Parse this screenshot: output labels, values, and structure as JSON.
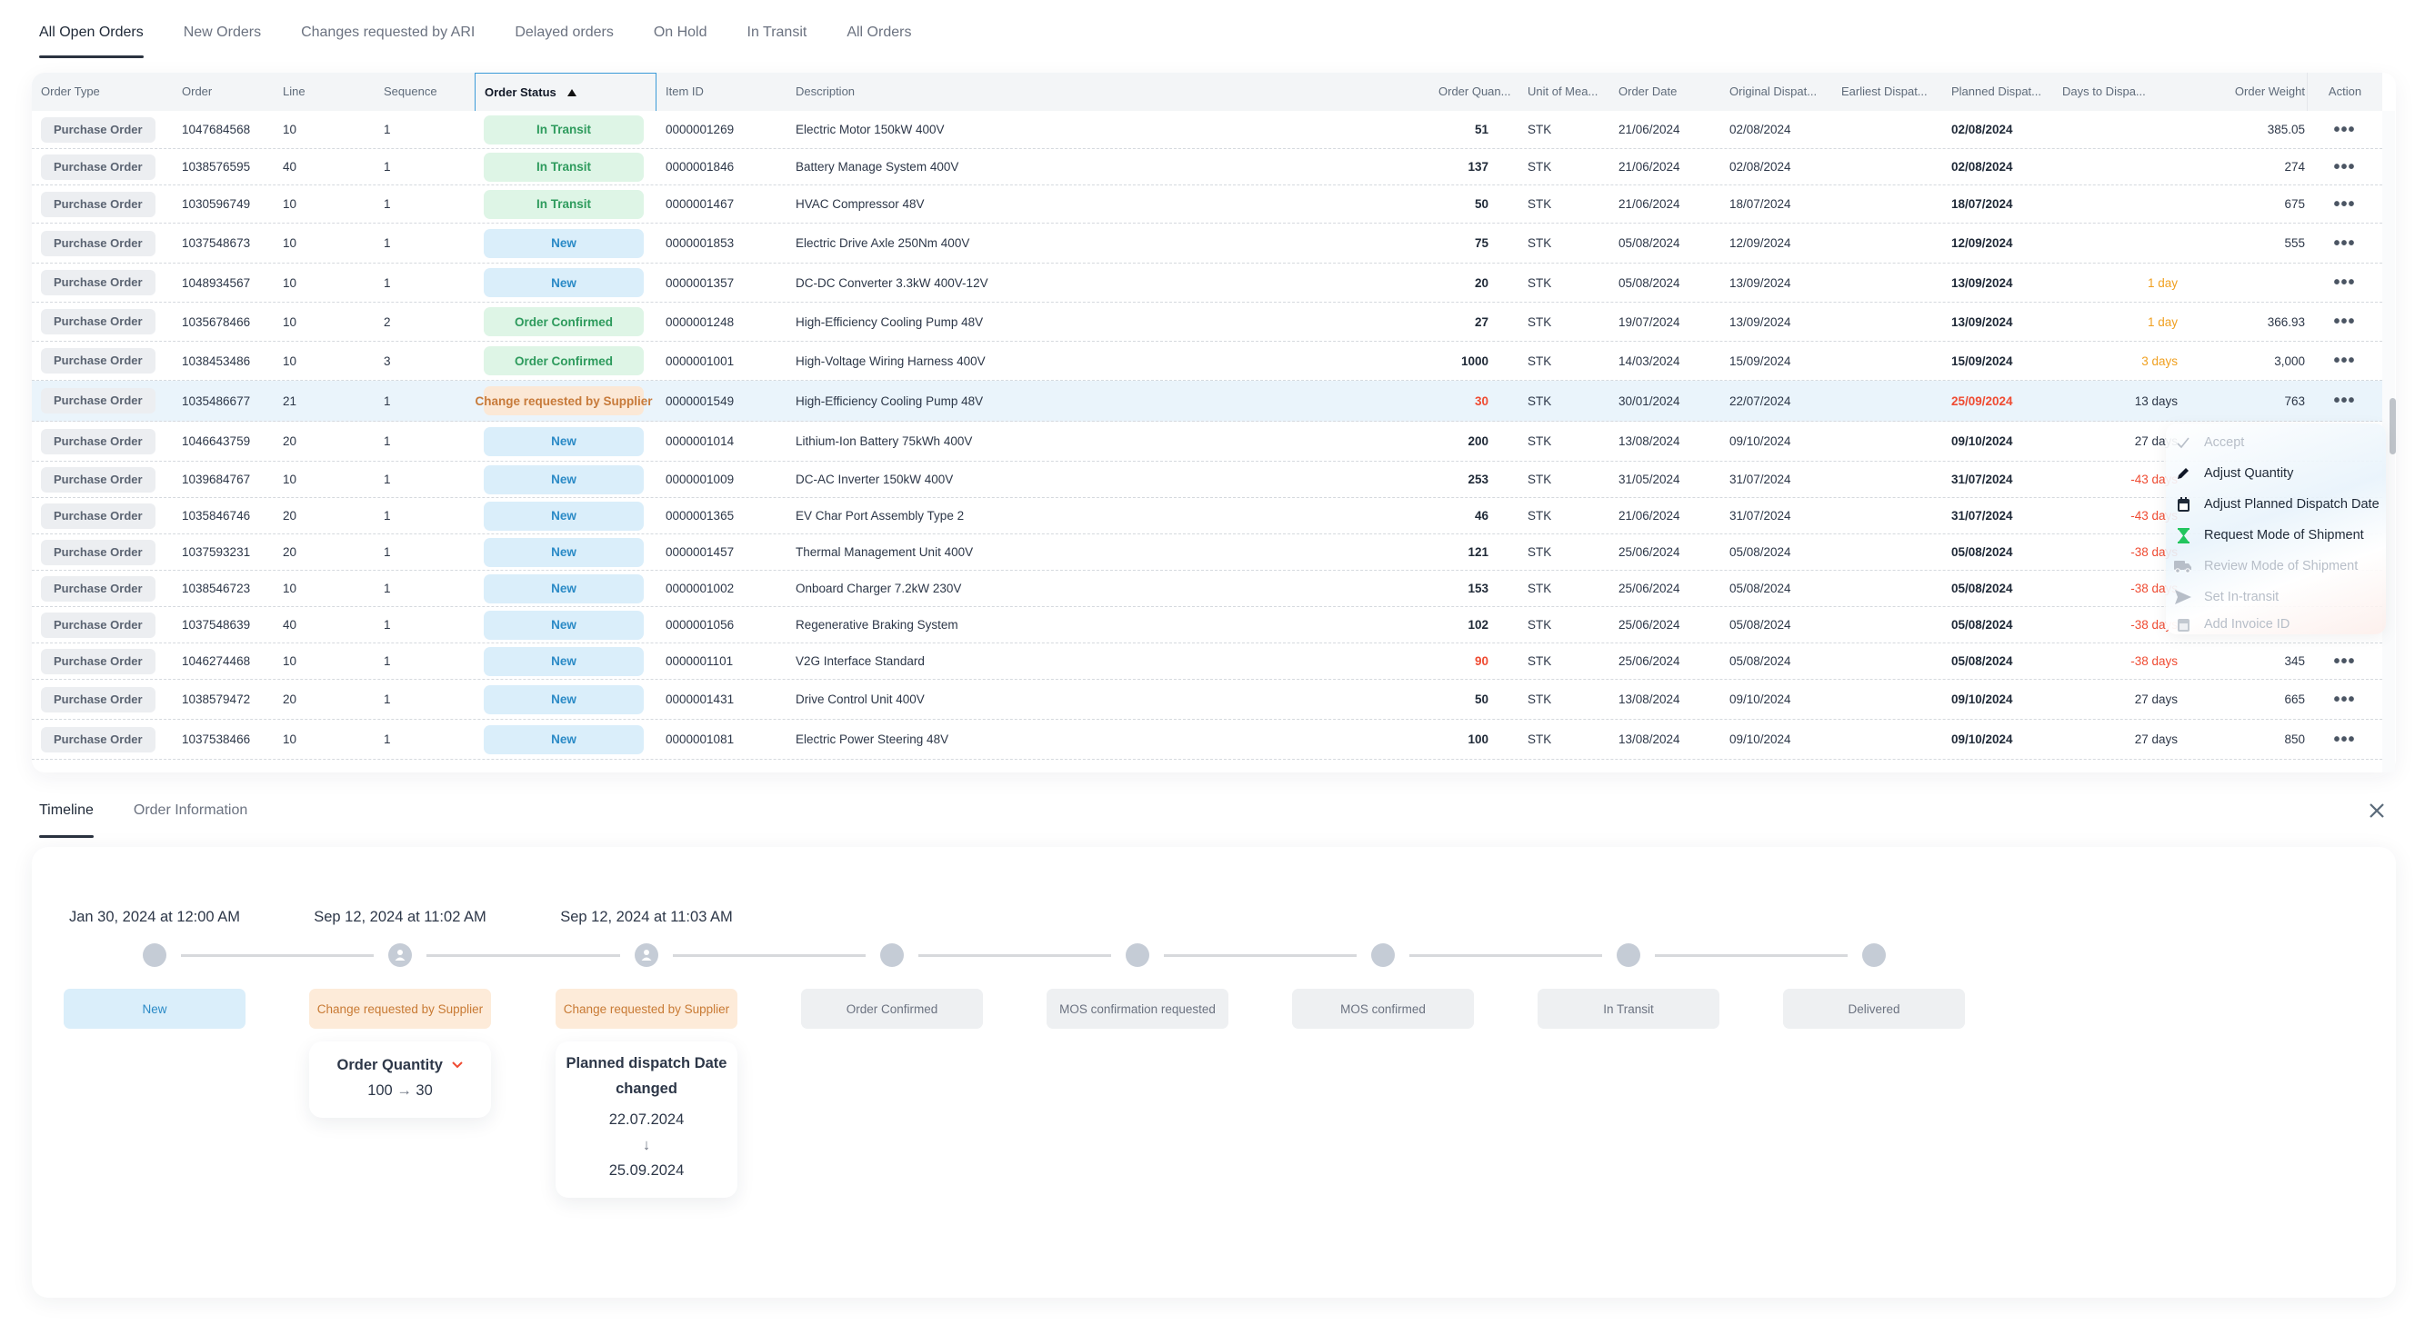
{
  "tabs": [
    {
      "label": "All Open Orders",
      "active": true
    },
    {
      "label": "New Orders",
      "active": false
    },
    {
      "label": "Changes requested by ARI",
      "active": false
    },
    {
      "label": "Delayed orders",
      "active": false
    },
    {
      "label": "On Hold",
      "active": false
    },
    {
      "label": "In Transit",
      "active": false
    },
    {
      "label": "All Orders",
      "active": false
    }
  ],
  "table": {
    "columns": {
      "order_type": "Order Type",
      "order": "Order",
      "line": "Line",
      "sequence": "Sequence",
      "order_status": "Order Status",
      "item_id": "Item ID",
      "description": "Description",
      "order_quantity": "Order Quan...",
      "unit": "Unit of Mea...",
      "order_date": "Order Date",
      "original_dispatch": "Original Dispat...",
      "earliest_dispatch": "Earliest Dispat...",
      "planned_dispatch": "Planned Dispat...",
      "days_to_dispatch": "Days to Dispa...",
      "order_weight": "Order Weight",
      "action": "Action"
    },
    "sorted_by": "Order Status",
    "sort_direction": "ascending",
    "action_icon": "more-horizontal-icon",
    "action_label": "•••",
    "rows": [
      {
        "type": "Purchase Order",
        "order": "1047684568",
        "line": "10",
        "sequence": "1",
        "status": "In Transit",
        "status_kind": "transit",
        "item_id": "0000001269",
        "description": "Electric Motor 150kW 400V",
        "qty": "51",
        "qty_alert": false,
        "unit": "STK",
        "order_date": "21/06/2024",
        "original_dispatch": "02/08/2024",
        "earliest_dispatch": "",
        "planned_dispatch": "02/08/2024",
        "planned_alert": false,
        "days": "",
        "days_kind": "",
        "weight": "385.05"
      },
      {
        "type": "Purchase Order",
        "order": "1038576595",
        "line": "40",
        "sequence": "1",
        "status": "In Transit",
        "status_kind": "transit",
        "item_id": "0000001846",
        "description": "Battery Manage System 400V",
        "qty": "137",
        "qty_alert": false,
        "unit": "STK",
        "order_date": "21/06/2024",
        "original_dispatch": "02/08/2024",
        "earliest_dispatch": "",
        "planned_dispatch": "02/08/2024",
        "planned_alert": false,
        "days": "",
        "days_kind": "",
        "weight": "274"
      },
      {
        "type": "Purchase Order",
        "order": "1030596749",
        "line": "10",
        "sequence": "1",
        "status": "In Transit",
        "status_kind": "transit",
        "item_id": "0000001467",
        "description": "HVAC Compressor 48V",
        "qty": "50",
        "qty_alert": false,
        "unit": "STK",
        "order_date": "21/06/2024",
        "original_dispatch": "18/07/2024",
        "earliest_dispatch": "",
        "planned_dispatch": "18/07/2024",
        "planned_alert": false,
        "days": "",
        "days_kind": "",
        "weight": "675"
      },
      {
        "type": "Purchase Order",
        "order": "1037548673",
        "line": "10",
        "sequence": "1",
        "status": "New",
        "status_kind": "new",
        "item_id": "0000001853",
        "description": "Electric Drive Axle 250Nm 400V",
        "qty": "75",
        "qty_alert": false,
        "unit": "STK",
        "order_date": "05/08/2024",
        "original_dispatch": "12/09/2024",
        "earliest_dispatch": "",
        "planned_dispatch": "12/09/2024",
        "planned_alert": false,
        "days": "",
        "days_kind": "",
        "weight": "555"
      },
      {
        "type": "Purchase Order",
        "order": "1048934567",
        "line": "10",
        "sequence": "1",
        "status": "New",
        "status_kind": "new",
        "item_id": "0000001357",
        "description": "DC-DC Converter 3.3kW 400V-12V",
        "qty": "20",
        "qty_alert": false,
        "unit": "STK",
        "order_date": "05/08/2024",
        "original_dispatch": "13/09/2024",
        "earliest_dispatch": "",
        "planned_dispatch": "13/09/2024",
        "planned_alert": false,
        "days": "1 day",
        "days_kind": "warning",
        "weight": ""
      },
      {
        "type": "Purchase Order",
        "order": "1035678466",
        "line": "10",
        "sequence": "2",
        "status": "Order Confirmed",
        "status_kind": "confirmed",
        "item_id": "0000001248",
        "description": "High-Efficiency Cooling Pump 48V",
        "qty": "27",
        "qty_alert": false,
        "unit": "STK",
        "order_date": "19/07/2024",
        "original_dispatch": "13/09/2024",
        "earliest_dispatch": "",
        "planned_dispatch": "13/09/2024",
        "planned_alert": false,
        "days": "1 day",
        "days_kind": "warning",
        "weight": "366.93"
      },
      {
        "type": "Purchase Order",
        "order": "1038453486",
        "line": "10",
        "sequence": "3",
        "status": "Order Confirmed",
        "status_kind": "confirmed",
        "item_id": "0000001001",
        "description": "High-Voltage Wiring Harness 400V",
        "qty": "1000",
        "qty_alert": false,
        "unit": "STK",
        "order_date": "14/03/2024",
        "original_dispatch": "15/09/2024",
        "earliest_dispatch": "",
        "planned_dispatch": "15/09/2024",
        "planned_alert": false,
        "days": "3 days",
        "days_kind": "warning",
        "weight": "3,000"
      },
      {
        "type": "Purchase Order",
        "order": "1035486677",
        "line": "21",
        "sequence": "1",
        "status": "Change requested by Supplier",
        "status_kind": "change",
        "item_id": "0000001549",
        "description": "High-Efficiency Cooling Pump 48V",
        "qty": "30",
        "qty_alert": true,
        "unit": "STK",
        "order_date": "30/01/2024",
        "original_dispatch": "22/07/2024",
        "earliest_dispatch": "",
        "planned_dispatch": "25/09/2024",
        "planned_alert": true,
        "days": "13 days",
        "days_kind": "normal",
        "weight": "763",
        "selected": true
      },
      {
        "type": "Purchase Order",
        "order": "1046643759",
        "line": "20",
        "sequence": "1",
        "status": "New",
        "status_kind": "new",
        "item_id": "0000001014",
        "description": "Lithium-Ion Battery 75kWh 400V",
        "qty": "200",
        "qty_alert": false,
        "unit": "STK",
        "order_date": "13/08/2024",
        "original_dispatch": "09/10/2024",
        "earliest_dispatch": "",
        "planned_dispatch": "09/10/2024",
        "planned_alert": false,
        "days": "27 days",
        "days_kind": "normal",
        "weight": ""
      },
      {
        "type": "Purchase Order",
        "order": "1039684767",
        "line": "10",
        "sequence": "1",
        "status": "New",
        "status_kind": "new",
        "item_id": "0000001009",
        "description": "DC-AC Inverter 150kW 400V",
        "qty": "253",
        "qty_alert": false,
        "unit": "STK",
        "order_date": "31/05/2024",
        "original_dispatch": "31/07/2024",
        "earliest_dispatch": "",
        "planned_dispatch": "31/07/2024",
        "planned_alert": false,
        "days": "-43 days",
        "days_kind": "overdue",
        "weight": ""
      },
      {
        "type": "Purchase Order",
        "order": "1035846746",
        "line": "20",
        "sequence": "1",
        "status": "New",
        "status_kind": "new",
        "item_id": "0000001365",
        "description": "EV Char Port Assembly Type 2",
        "qty": "46",
        "qty_alert": false,
        "unit": "STK",
        "order_date": "21/06/2024",
        "original_dispatch": "31/07/2024",
        "earliest_dispatch": "",
        "planned_dispatch": "31/07/2024",
        "planned_alert": false,
        "days": "-43 days",
        "days_kind": "overdue",
        "weight": ""
      },
      {
        "type": "Purchase Order",
        "order": "1037593231",
        "line": "20",
        "sequence": "1",
        "status": "New",
        "status_kind": "new",
        "item_id": "0000001457",
        "description": "Thermal Management Unit 400V",
        "qty": "121",
        "qty_alert": false,
        "unit": "STK",
        "order_date": "25/06/2024",
        "original_dispatch": "05/08/2024",
        "earliest_dispatch": "",
        "planned_dispatch": "05/08/2024",
        "planned_alert": false,
        "days": "-38 days",
        "days_kind": "overdue",
        "weight": ""
      },
      {
        "type": "Purchase Order",
        "order": "1038546723",
        "line": "10",
        "sequence": "1",
        "status": "New",
        "status_kind": "new",
        "item_id": "0000001002",
        "description": "Onboard Charger 7.2kW 230V",
        "qty": "153",
        "qty_alert": false,
        "unit": "STK",
        "order_date": "25/06/2024",
        "original_dispatch": "05/08/2024",
        "earliest_dispatch": "",
        "planned_dispatch": "05/08/2024",
        "planned_alert": false,
        "days": "-38 days",
        "days_kind": "overdue",
        "weight": ""
      },
      {
        "type": "Purchase Order",
        "order": "1037548639",
        "line": "40",
        "sequence": "1",
        "status": "New",
        "status_kind": "new",
        "item_id": "0000001056",
        "description": "Regenerative Braking System",
        "qty": "102",
        "qty_alert": false,
        "unit": "STK",
        "order_date": "25/06/2024",
        "original_dispatch": "05/08/2024",
        "earliest_dispatch": "",
        "planned_dispatch": "05/08/2024",
        "planned_alert": false,
        "days": "-38 days",
        "days_kind": "overdue",
        "weight": ""
      },
      {
        "type": "Purchase Order",
        "order": "1046274468",
        "line": "10",
        "sequence": "1",
        "status": "New",
        "status_kind": "new",
        "item_id": "0000001101",
        "description": "V2G Interface Standard",
        "qty": "90",
        "qty_alert": true,
        "unit": "STK",
        "order_date": "25/06/2024",
        "original_dispatch": "05/08/2024",
        "earliest_dispatch": "",
        "planned_dispatch": "05/08/2024",
        "planned_alert": false,
        "days": "-38 days",
        "days_kind": "overdue",
        "weight": "345"
      },
      {
        "type": "Purchase Order",
        "order": "1038579472",
        "line": "20",
        "sequence": "1",
        "status": "New",
        "status_kind": "new",
        "item_id": "0000001431",
        "description": "Drive Control Unit 400V",
        "qty": "50",
        "qty_alert": false,
        "unit": "STK",
        "order_date": "13/08/2024",
        "original_dispatch": "09/10/2024",
        "earliest_dispatch": "",
        "planned_dispatch": "09/10/2024",
        "planned_alert": false,
        "days": "27 days",
        "days_kind": "normal",
        "weight": "665"
      },
      {
        "type": "Purchase Order",
        "order": "1037538466",
        "line": "10",
        "sequence": "1",
        "status": "New",
        "status_kind": "new",
        "item_id": "0000001081",
        "description": "Electric Power Steering 48V",
        "qty": "100",
        "qty_alert": false,
        "unit": "STK",
        "order_date": "13/08/2024",
        "original_dispatch": "09/10/2024",
        "earliest_dispatch": "",
        "planned_dispatch": "09/10/2024",
        "planned_alert": false,
        "days": "27 days",
        "days_kind": "normal",
        "weight": "850"
      }
    ]
  },
  "action_menu": {
    "items": [
      {
        "label": "Accept",
        "icon": "check-icon",
        "disabled": true
      },
      {
        "label": "Adjust Quantity",
        "icon": "pencil-icon",
        "disabled": false
      },
      {
        "label": "Adjust Planned Dispatch Date",
        "icon": "calendar-icon",
        "disabled": false
      },
      {
        "label": "Request Mode of Shipment",
        "icon": "hourglass-icon",
        "disabled": false
      },
      {
        "label": "Review Mode of Shipment",
        "icon": "truck-icon",
        "disabled": true
      },
      {
        "label": "Set In-transit",
        "icon": "send-icon",
        "disabled": true
      },
      {
        "label": "Add Invoice ID",
        "icon": "calendar-icon",
        "disabled": true
      }
    ]
  },
  "detail_panel": {
    "tabs": [
      {
        "label": "Timeline",
        "active": true
      },
      {
        "label": "Order Information",
        "active": false
      }
    ],
    "close_icon": "close-icon",
    "timeline": [
      {
        "date": "Jan 30, 2024 at 12:00 AM",
        "status": "New",
        "kind": "new",
        "node_icon": "dot"
      },
      {
        "date": "Sep 12, 2024 at 11:02 AM",
        "status": "Change requested by Supplier",
        "kind": "change",
        "node_icon": "user-icon"
      },
      {
        "date": "Sep 12, 2024 at 11:03 AM",
        "status": "Change requested by Supplier",
        "kind": "change",
        "node_icon": "user-icon"
      },
      {
        "date": "",
        "status": "Order Confirmed",
        "kind": "future",
        "node_icon": "dot"
      },
      {
        "date": "",
        "status": "MOS confirmation requested",
        "kind": "future",
        "node_icon": "dot"
      },
      {
        "date": "",
        "status": "MOS confirmed",
        "kind": "future",
        "node_icon": "dot"
      },
      {
        "date": "",
        "status": "In Transit",
        "kind": "future",
        "node_icon": "dot"
      },
      {
        "date": "",
        "status": "Delivered",
        "kind": "future",
        "node_icon": "dot"
      }
    ],
    "changes": {
      "quantity": {
        "title": "Order Quantity",
        "from": "100",
        "to": "30",
        "arrow": "→",
        "trend_icon": "chevron-down-icon"
      },
      "dispatch": {
        "title_line1": "Planned dispatch Date",
        "title_line2": "changed",
        "from": "22.07.2024",
        "to": "25.09.2024",
        "arrow": "↓"
      }
    }
  },
  "colors": {
    "accent_blue": "#3b9bd8",
    "status_transit": "#2e9b5d",
    "status_new": "#2a8ac6",
    "status_change": "#c77a3a",
    "alert_red": "#ef4b32",
    "warning_orange": "#f0a020",
    "selected_row": "#eaf4fb"
  }
}
